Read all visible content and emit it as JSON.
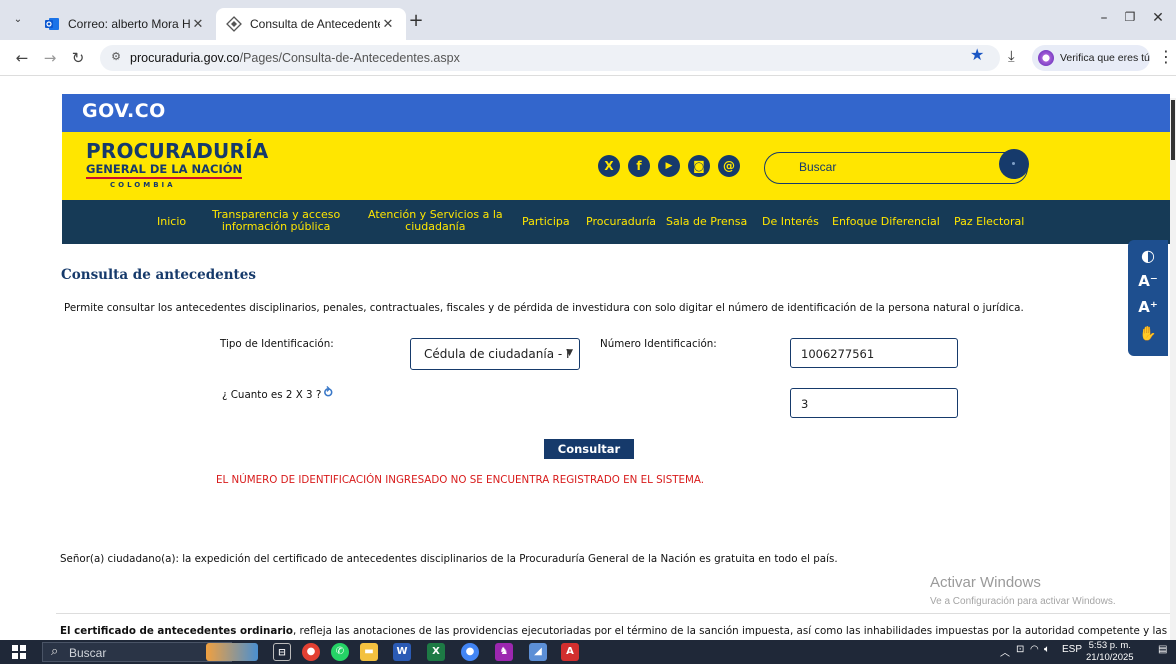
{
  "browser": {
    "tabs": [
      {
        "title": "Correo: alberto Mora Hernandez",
        "active": false
      },
      {
        "title": "Consulta de Antecedentes",
        "active": true
      }
    ],
    "url_host": "procuraduria.gov.co",
    "url_path": "/Pages/Consulta-de-Antecedentes.aspx",
    "profile_label": "Verifica que eres tú"
  },
  "site": {
    "gov_logo": "GOV.CO",
    "logo": {
      "line1": "PROCURADURÍA",
      "line2": "GENERAL DE LA NACIÓN",
      "line3": "COLOMBIA"
    },
    "social_icons": [
      "x-icon",
      "facebook-icon",
      "youtube-icon",
      "instagram-icon",
      "threads-icon"
    ],
    "search_placeholder": "Buscar",
    "nav": [
      "Inicio",
      "Transparencia y acceso\ninformación pública",
      "Atención y Servicios a la\nciudadanía",
      "Participa",
      "Procuraduría",
      "Sala de Prensa",
      "De Interés",
      "Enfoque Diferencial",
      "Paz Electoral"
    ],
    "colors": {
      "gov_blue": "#3366cc",
      "yellow": "#ffe600",
      "navy": "#163a6b",
      "error_red": "#d81b1b"
    }
  },
  "form": {
    "title": "Consulta de antecedentes",
    "description": "Permite consultar los antecedentes disciplinarios, penales, contractuales, fiscales y de pérdida de investidura con solo digitar el número de identificación de la persona natural o jurídica.",
    "id_type_label": "Tipo de Identificación:",
    "id_type_value": "Cédula de ciudadanía - I",
    "id_number_label": "Número Identificación:",
    "id_number_value": "1006277561",
    "captcha_label": "¿ Cuanto es 2 X 3 ?",
    "captcha_value": "3",
    "submit_label": "Consultar",
    "error_message": "EL NÚMERO DE IDENTIFICACIÓN INGRESADO NO SE ENCUENTRA REGISTRADO EN EL SISTEMA."
  },
  "info": {
    "notice": "Señor(a) ciudadano(a): la expedición del certificado de antecedentes disciplinarios de la Procuraduría General de la Nación es gratuita en todo el país.",
    "ordinario_bold": "El certificado de antecedentes ordinario",
    "ordinario_rest": ", refleja las anotaciones de las providencias ejecutoriadas por el término de la sanción impuesta, así como las inhabilidades impuestas por la autoridad competente y las automáticas que ord"
  },
  "watermark": {
    "line1": "Activar Windows",
    "line2": "Ve a Configuración para activar Windows."
  },
  "taskbar": {
    "search_label": "Buscar",
    "lang": "ESP",
    "time": "5:53 p. m.",
    "date": "21/10/2025"
  }
}
